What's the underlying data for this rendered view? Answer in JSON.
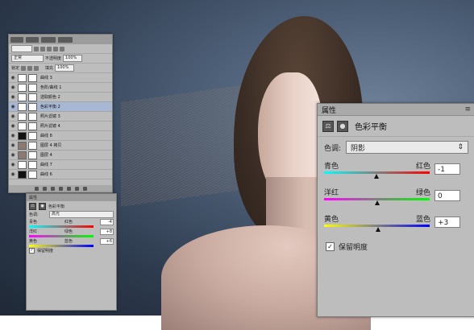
{
  "layers_panel": {
    "tab_labels": [
      "",
      "",
      "",
      ""
    ],
    "blend_mode": "正常",
    "opacity_label": "不透明度",
    "opacity_value": "100%",
    "lock_label": "锁定",
    "fill_label": "填充",
    "fill_value": "100%",
    "layers": [
      {
        "name": "曲线 3",
        "thumb": "#ffffff",
        "selected": false
      },
      {
        "name": "色阶/曲线 1",
        "thumb": "#ffffff",
        "selected": false
      },
      {
        "name": "选取颜色 2",
        "thumb": "#ffffff",
        "selected": false
      },
      {
        "name": "色彩平衡 2",
        "thumb": "#ffffff",
        "selected": true
      },
      {
        "name": "照片滤镜 3",
        "thumb": "#ffffff",
        "selected": false
      },
      {
        "name": "照片滤镜 4",
        "thumb": "#ffffff",
        "selected": false
      },
      {
        "name": "曲线 8",
        "thumb": "#111111",
        "selected": false
      },
      {
        "name": "图层 4 拷贝",
        "thumb": "#8a7a72",
        "selected": false
      },
      {
        "name": "图层 4",
        "thumb": "#8a7a72",
        "selected": false
      },
      {
        "name": "曲线 7",
        "thumb": "#ffffff",
        "selected": false
      },
      {
        "name": "曲线 6",
        "thumb": "#111111",
        "selected": false
      }
    ]
  },
  "small_properties": {
    "tab": "属性",
    "title": "色彩平衡",
    "tone_label": "色调:",
    "tone_value": "高光",
    "sliders": [
      {
        "left": "青色",
        "right": "红色",
        "value": "-4"
      },
      {
        "left": "洋红",
        "right": "绿色",
        "value": "+8"
      },
      {
        "left": "黄色",
        "right": "蓝色",
        "value": "+6"
      }
    ],
    "preserve_label": "保留明度"
  },
  "properties": {
    "tab": "属性",
    "menu_icon": "menu-icon",
    "title": "色彩平衡",
    "tone_label": "色调:",
    "tone_value": "阴影",
    "sliders": [
      {
        "left": "青色",
        "right": "红色",
        "value": "-1",
        "position": -1
      },
      {
        "left": "洋红",
        "right": "绿色",
        "value": "0",
        "position": 0
      },
      {
        "left": "黄色",
        "right": "蓝色",
        "value": "+3",
        "position": 3
      }
    ],
    "preserve_label": "保留明度",
    "preserve_checked": "✓"
  }
}
